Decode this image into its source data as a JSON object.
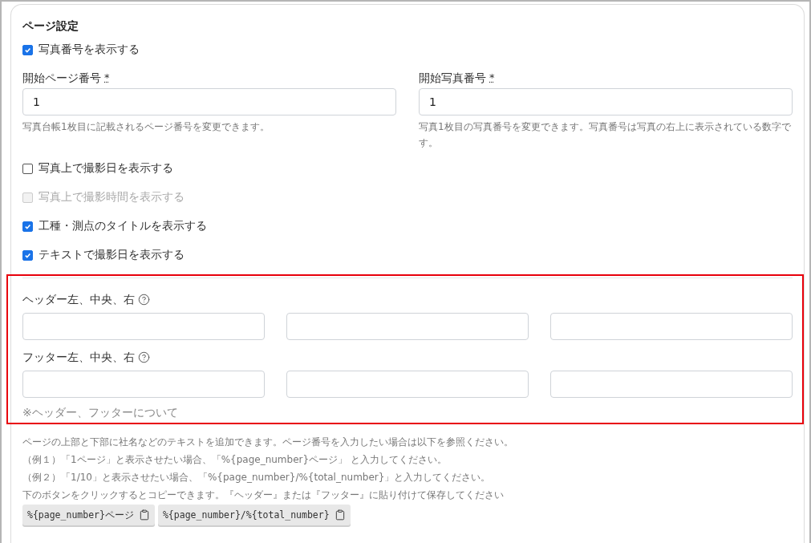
{
  "section": {
    "title": "ページ設定"
  },
  "show_photo_number": {
    "label": "写真番号を表示する",
    "checked": true
  },
  "fields": [
    {
      "label": "開始ページ番号",
      "required_mark": "*",
      "value": "1",
      "help": "写真台帳1枚目に記載されるページ番号を変更できます。"
    },
    {
      "label": "開始写真番号",
      "required_mark": "*",
      "value": "1",
      "help": "写真1枚目の写真番号を変更できます。写真番号は写真の右上に表示されている数字です。"
    }
  ],
  "options": [
    {
      "label": "写真上で撮影日を表示する",
      "checked": false,
      "disabled": false
    },
    {
      "label": "写真上で撮影時間を表示する",
      "checked": false,
      "disabled": true
    },
    {
      "label": "工種・測点のタイトルを表示する",
      "checked": true,
      "disabled": false
    },
    {
      "label": "テキストで撮影日を表示する",
      "checked": true,
      "disabled": false
    }
  ],
  "header_footer": {
    "highlighted": true,
    "rows": [
      {
        "label": "ヘッダー左、中央、右"
      },
      {
        "label": "フッター左、中央、右"
      }
    ],
    "note_heading": "※ヘッダー、フッターについて"
  },
  "note": {
    "lines": [
      "ページの上部と下部に社名などのテキストを追加できます。ページ番号を入力したい場合は以下を参照ください。",
      "（例１）「1ページ」と表示させたい場合、「%{page_number}ページ」 と入力してください。",
      "（例２）「1/10」と表示させたい場合、「%{page_number}/%{total_number}」と入力してください。",
      "下のボタンをクリックするとコピーできます。『ヘッダー』または『フッター』に貼り付けて保存してください"
    ],
    "copy_buttons": [
      "%{page_number}ページ",
      "%{page_number}/%{total_number}"
    ]
  }
}
